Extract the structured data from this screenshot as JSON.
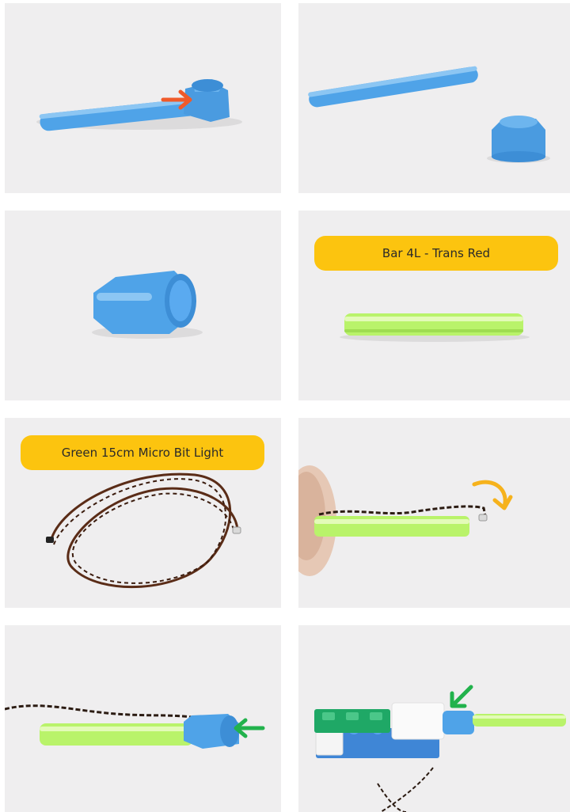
{
  "steps": [
    {
      "id": 1,
      "label": ""
    },
    {
      "id": 2,
      "label": ""
    },
    {
      "id": 3,
      "label": ""
    },
    {
      "id": 4,
      "label": "Bar 4L - Trans Red"
    },
    {
      "id": 5,
      "label": "Green 15cm Micro Bit Light"
    },
    {
      "id": 6,
      "label": ""
    },
    {
      "id": 7,
      "label": ""
    },
    {
      "id": 8,
      "label": ""
    }
  ],
  "colors": {
    "tile_background": "#efeeef",
    "label_background": "#fcc40f",
    "part_blue": "#4fa3e8",
    "part_trans_green": "#b9f36a",
    "arrow_red": "#f05a2a",
    "arrow_yellow": "#f6b21c",
    "arrow_green": "#22b24c",
    "brick_green": "#1fa866"
  },
  "icons": [
    "arrow-right-red-icon",
    "curved-arrow-yellow-icon",
    "arrow-left-green-icon",
    "arrow-down-left-green-icon"
  ]
}
